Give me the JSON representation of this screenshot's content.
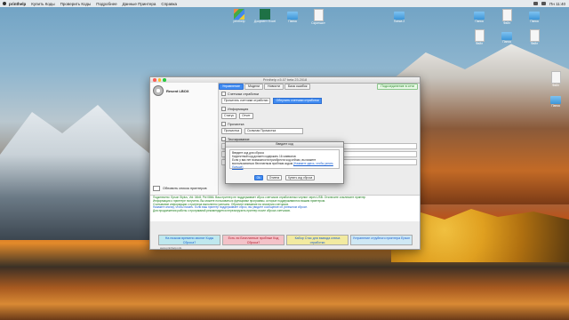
{
  "menubar": {
    "app": "printhelp",
    "items": [
      "Купить Коды",
      "Проверить Коды",
      "Подробнее",
      "Данные Принтера",
      "Справка"
    ],
    "clock": "Пн 11:40"
  },
  "desktop": {
    "icons": [
      {
        "label": "printhelp",
        "kind": "multi"
      },
      {
        "label": "Документ Excel",
        "kind": "excel"
      },
      {
        "label": "Папка",
        "kind": "folder"
      },
      {
        "label": "Скриншот",
        "kind": "file"
      },
      {
        "label": "Папка 2",
        "kind": "folder"
      }
    ],
    "right_icons": [
      "Папка",
      "Файл",
      "Папка",
      "Файл",
      "Папка",
      "Файл",
      "Файл",
      "Папка"
    ]
  },
  "window": {
    "title": "Printhelp v.5.07 beta 23.2018",
    "brand": "Resent LBOX",
    "reset_button": "Обновить список принтеров",
    "tabs": [
      "Управление",
      "Модели",
      "Новости",
      "База ошибок"
    ],
    "active_tab": "Управление",
    "status_tab": "Подсоединение в сети",
    "sections": {
      "counters": {
        "title": "Счетчики отработки",
        "label": "Прочитать счетчики отработки",
        "button": "Обнулить счетчики отработки"
      },
      "info": {
        "title": "Информация",
        "btn1": "Статус",
        "btn2": "Отчет"
      },
      "print": {
        "title": "Прочистка",
        "label": "Прочистка",
        "select": "Сильная Прочистка"
      },
      "test": {
        "title": "Тестирование"
      }
    },
    "dialog": {
      "title": "Введите код",
      "lines": [
        "Введите код для сброса",
        "Корректный код должен содержать 16 символов",
        "Если у вас нет возможности приобрести код сейчас, вы можете",
        "воспользоваться бесплатным пробным кодом"
      ],
      "link": "(Нажмите здесь, чтобы узнать больше)",
      "ok": "Ok",
      "cancel": "Отмена",
      "buy": "Купить код сброса"
    },
    "info_lines": [
      {
        "text": "Подключено: Epson Stylus, Vid: 04b8; Pid 0866. Ваш принтер не поддерживает сброс счетчиков отработанных чернил через USB. Отключите и включите принтер",
        "color": "green"
      },
      {
        "text": "Информация о принтере получена. Вы можете пользоваться функциями программы, которые поддерживаются вашим принтером.",
        "color": "green"
      },
      {
        "text": "Считывание информации с принтера выполнено успешно. Обратите внимание на значения счетчиков.",
        "color": "green"
      },
      {
        "text": "Нажмите кнопку, чтобы начать. Если ваш принтер поддерживает сброс, вы увидите сообщение об успешном сбросе.",
        "color": "blue"
      },
      {
        "text": "Для продолжения работы с программой рекомендуется перезагрузить принтер после сброса счетчиков.",
        "color": "green"
      }
    ],
    "banners": [
      "На низком времени звонят Коды Сброса?",
      "Есть ли Бесплатные пробные Код Сброса?",
      "Кабор Стас для вывода ключа отработки",
      "Устранение струйного принтера Epson"
    ],
    "site": "www.printhelp.info"
  }
}
